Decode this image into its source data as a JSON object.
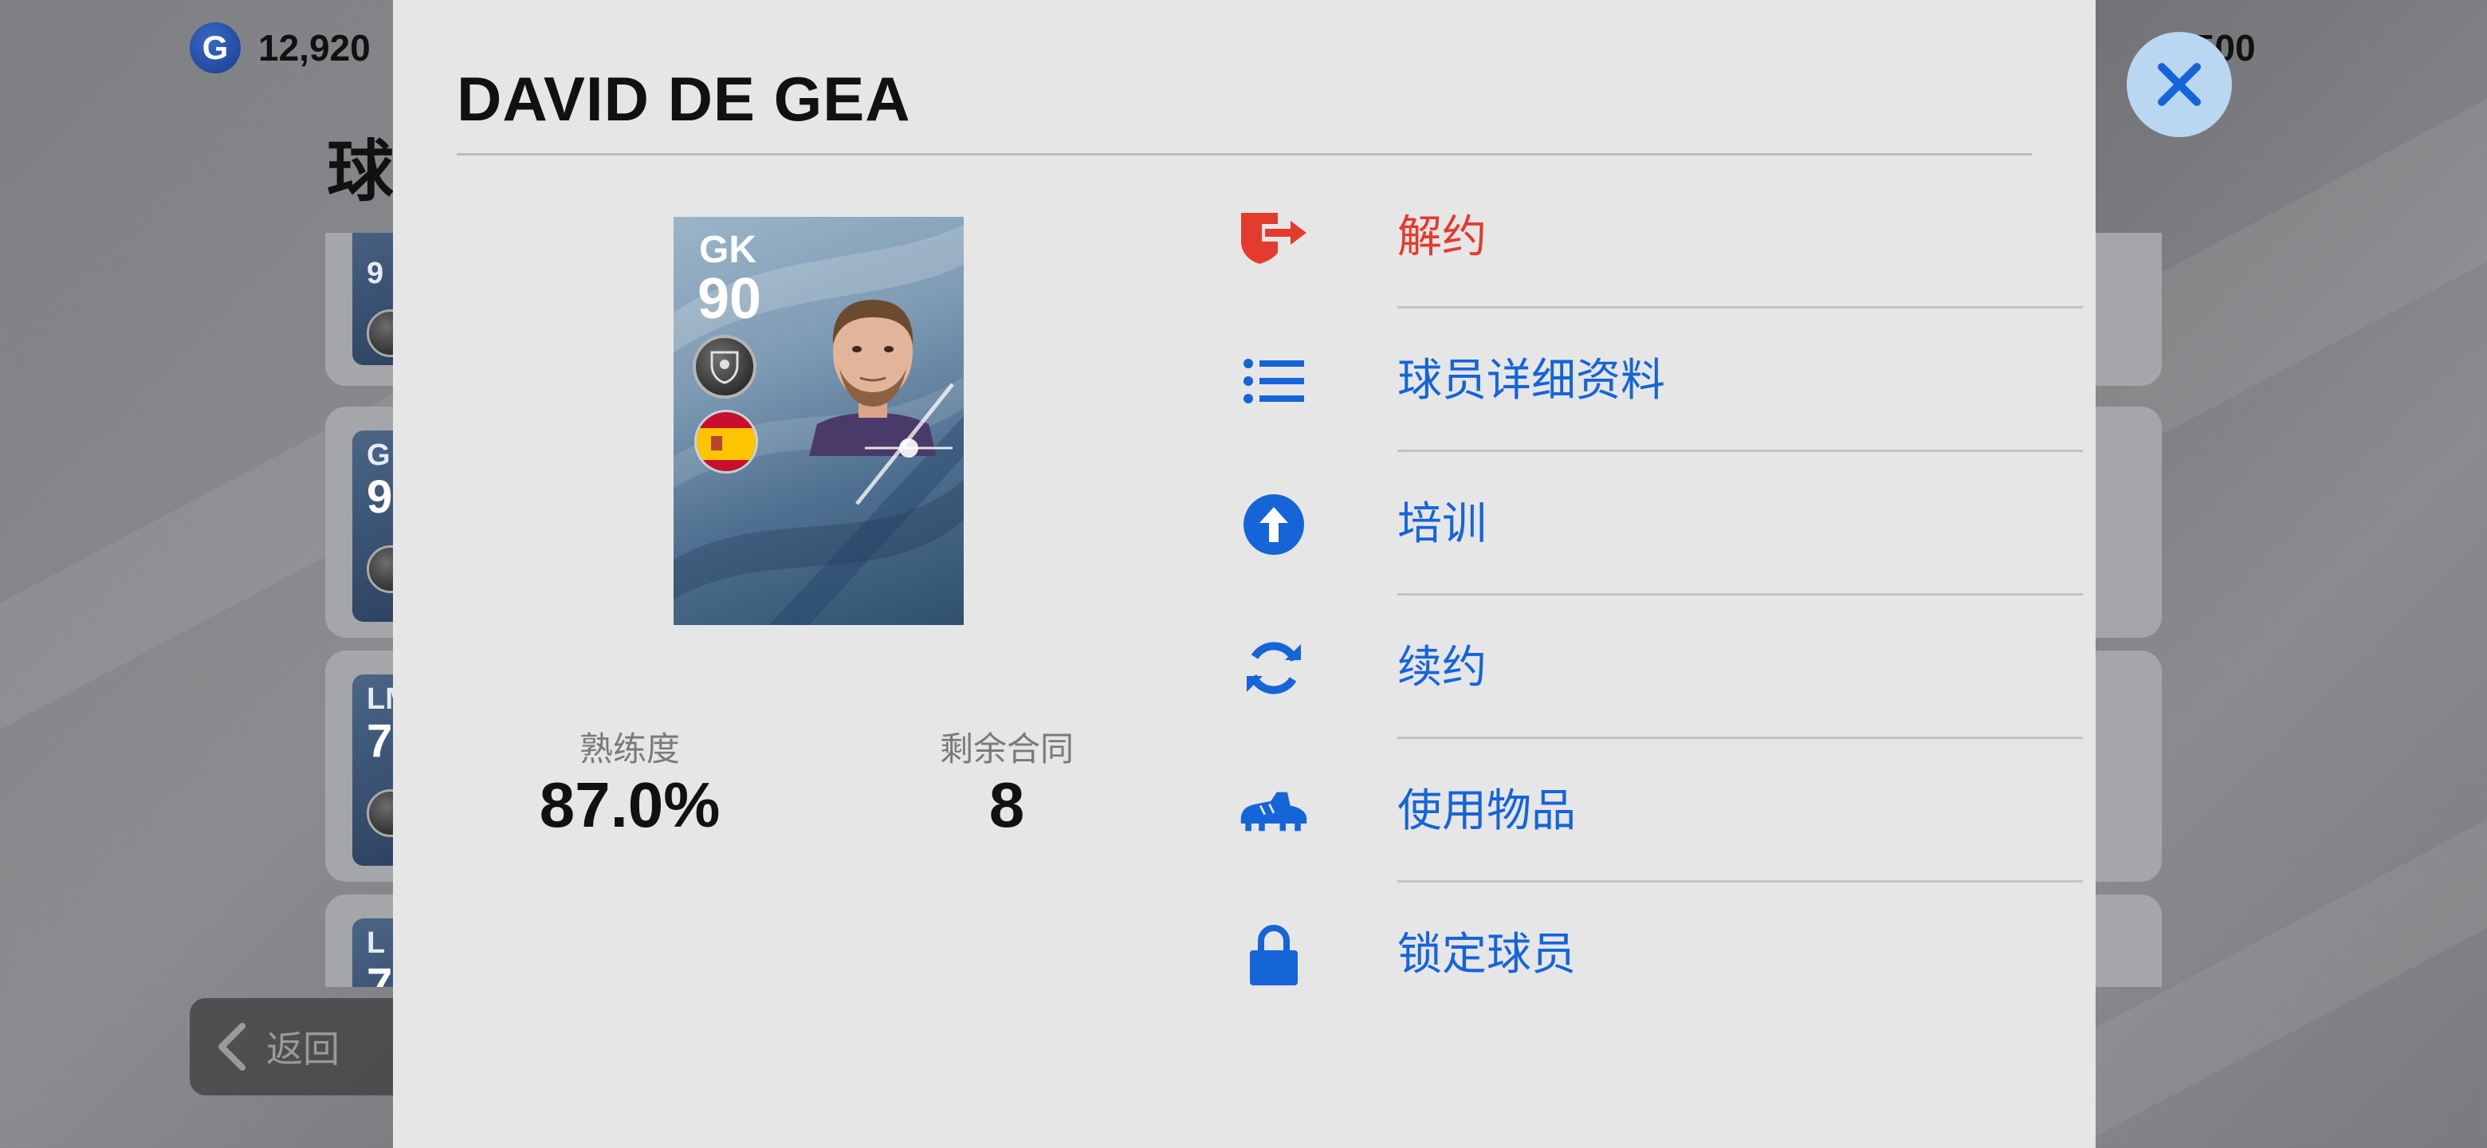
{
  "background": {
    "currency_value": "12,920",
    "squad_count": "/500",
    "heading": "球",
    "rows": [
      {
        "pos": "9",
        "rating": ""
      },
      {
        "pos": "G",
        "rating": "9"
      },
      {
        "pos": "LM",
        "rating": "7"
      },
      {
        "pos": "L",
        "rating": "7"
      }
    ],
    "back_label": "返回"
  },
  "modal": {
    "title": "DAVID DE GEA",
    "card": {
      "position": "GK",
      "rating": "90",
      "nationality_flag": "spain-flag",
      "club_badge": "club-badge-icon"
    },
    "stats": [
      {
        "label": "熟练度",
        "value": "87.0%"
      },
      {
        "label": "剩余合同",
        "value": "8"
      }
    ],
    "menu": [
      {
        "label": "解约",
        "icon": "release-contract-icon",
        "color": "#e33b2e"
      },
      {
        "label": "球员详细资料",
        "icon": "list-icon",
        "color": "#1565d8"
      },
      {
        "label": "培训",
        "icon": "arrow-up-circle-icon",
        "color": "#1565d8"
      },
      {
        "label": "续约",
        "icon": "renew-icon",
        "color": "#1565d8"
      },
      {
        "label": "使用物品",
        "icon": "boot-icon",
        "color": "#1565d8"
      },
      {
        "label": "锁定球员",
        "icon": "lock-icon",
        "color": "#1565d8"
      }
    ]
  },
  "colors": {
    "accent_blue": "#1565d8",
    "danger_red": "#e33b2e",
    "modal_bg": "#e6e6e6",
    "close_bg": "#b9d7f0"
  }
}
